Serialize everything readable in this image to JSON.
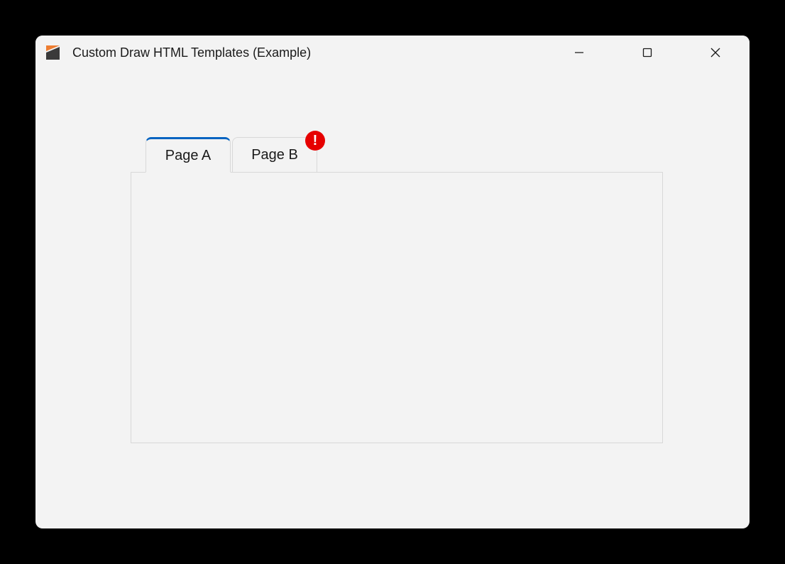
{
  "window": {
    "title": "Custom Draw HTML Templates (Example)"
  },
  "tabs": [
    {
      "label": "Page A",
      "active": true,
      "badge": null
    },
    {
      "label": "Page B",
      "active": false,
      "badge": "!"
    }
  ],
  "colors": {
    "accent": "#0363c1",
    "badge": "#e60000"
  }
}
